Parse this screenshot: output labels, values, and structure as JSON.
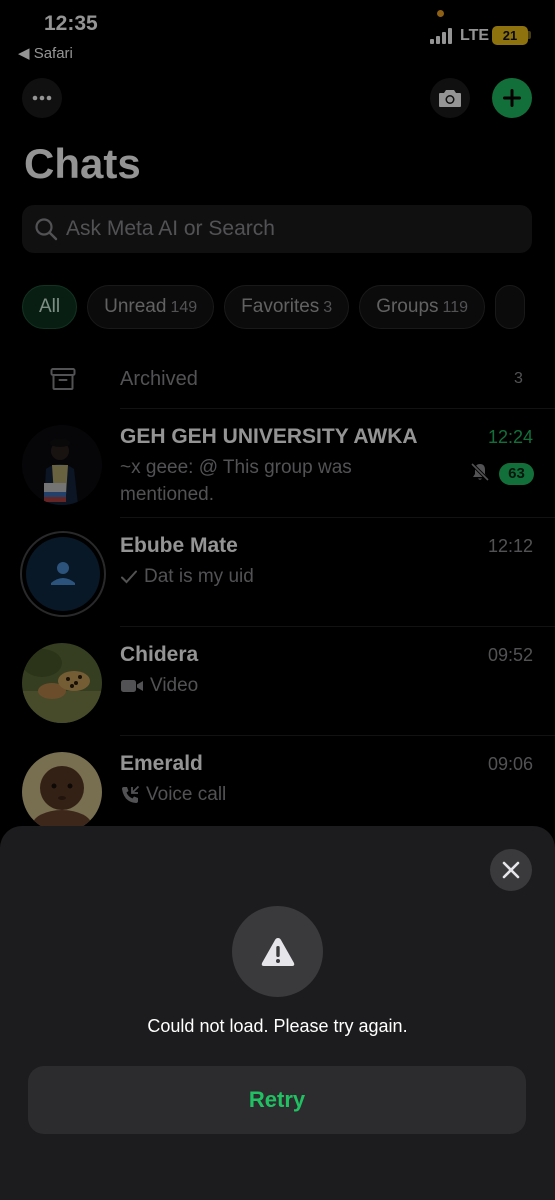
{
  "status_bar": {
    "time": "12:35",
    "back_app": "◀ Safari",
    "network": "LTE",
    "battery": "21"
  },
  "header": {
    "title": "Chats",
    "more_icon": "ellipsis-icon",
    "camera_icon": "camera-icon",
    "new_chat_icon": "plus-icon"
  },
  "search": {
    "placeholder": "Ask Meta AI or Search"
  },
  "filters": [
    {
      "label": "All",
      "count": ""
    },
    {
      "label": "Unread",
      "count": "149"
    },
    {
      "label": "Favorites",
      "count": "3"
    },
    {
      "label": "Groups",
      "count": "119"
    }
  ],
  "archived": {
    "label": "Archived",
    "count": "3"
  },
  "chats": [
    {
      "name": "GEH GEH UNIVERSITY AWKA",
      "time": "12:24",
      "preview": "~x geee: @ This group was mentioned.",
      "unread": "63",
      "muted": true
    },
    {
      "name": "Ebube Mate",
      "time": "12:12",
      "preview": "Dat is my uid"
    },
    {
      "name": "Chidera",
      "time": "09:52",
      "preview": "Video"
    },
    {
      "name": "Emerald",
      "time": "09:06",
      "preview": "Voice call"
    }
  ],
  "sheet": {
    "message": "Could not load. Please try again.",
    "retry_label": "Retry"
  },
  "colors": {
    "accent": "#21c063",
    "background": "#000000",
    "sheet": "#1c1c1e"
  }
}
